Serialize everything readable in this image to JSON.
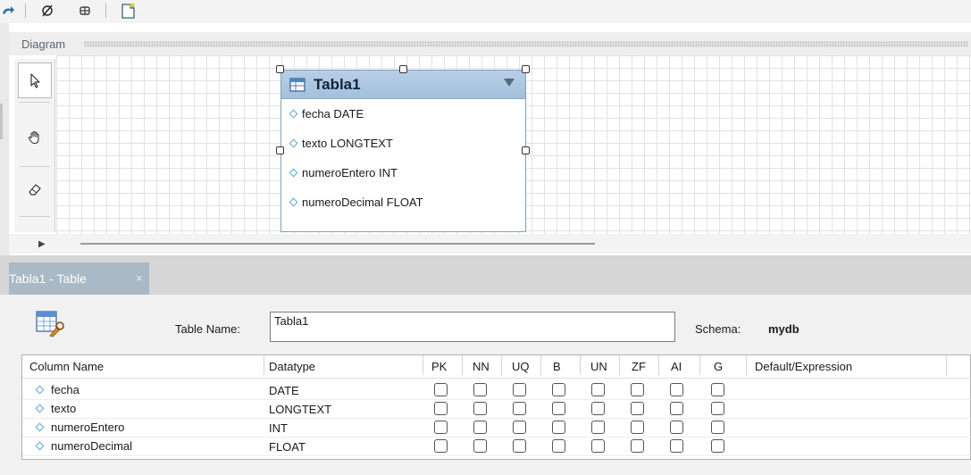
{
  "diagram": {
    "title": "Diagram",
    "tools": [
      {
        "name": "pointer-icon",
        "selected": true
      },
      {
        "name": "hand-icon",
        "selected": false
      },
      {
        "name": "eraser-icon",
        "selected": false
      }
    ]
  },
  "er_table": {
    "title": "Tabla1",
    "columns": [
      {
        "label": "fecha DATE"
      },
      {
        "label": "texto LONGTEXT"
      },
      {
        "label": "numeroEntero INT"
      },
      {
        "label": "numeroDecimal FLOAT"
      }
    ]
  },
  "tab": {
    "label": "Tabla1 - Table",
    "close": "×"
  },
  "editor": {
    "table_name_label": "Table Name:",
    "table_name_value": "Tabla1",
    "schema_label": "Schema:",
    "schema_value": "mydb"
  },
  "grid": {
    "headers": {
      "column_name": "Column Name",
      "datatype": "Datatype",
      "pk": "PK",
      "nn": "NN",
      "uq": "UQ",
      "b": "B",
      "un": "UN",
      "zf": "ZF",
      "ai": "AI",
      "g": "G",
      "default": "Default/Expression"
    },
    "rows": [
      {
        "name": "fecha",
        "datatype": "DATE"
      },
      {
        "name": "texto",
        "datatype": "LONGTEXT"
      },
      {
        "name": "numeroEntero",
        "datatype": "INT"
      },
      {
        "name": "numeroDecimal",
        "datatype": "FLOAT"
      }
    ]
  },
  "colors": {
    "er_header": "#a3c0dc",
    "tab_active": "#a9b9c6",
    "column_diamond": "#5aa8d6"
  }
}
